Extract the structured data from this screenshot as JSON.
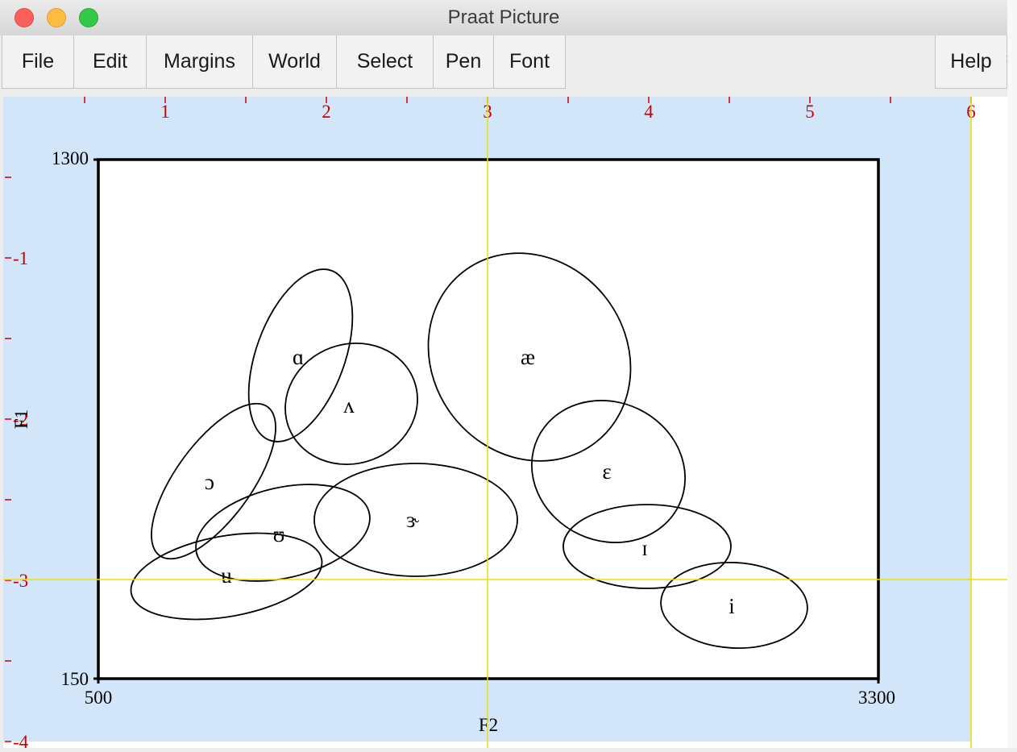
{
  "window": {
    "title": "Praat Picture"
  },
  "menu": [
    {
      "label": "File"
    },
    {
      "label": "Edit"
    },
    {
      "label": "Margins"
    },
    {
      "label": "World"
    },
    {
      "label": "Select"
    },
    {
      "label": "Pen"
    },
    {
      "label": "Font"
    },
    {
      "label": "Help"
    }
  ],
  "colors": {
    "selection": "#d3e5f8",
    "ruler": "#cc0000",
    "guide": "#f0e000",
    "ink": "#000000"
  },
  "rulers": {
    "top": [
      "1",
      "2",
      "3",
      "4",
      "5",
      "6"
    ],
    "left": [
      "-1",
      "-2",
      "-3",
      "-4"
    ]
  },
  "plot": {
    "y_max_label": "1300",
    "y_min_label": "150",
    "x_min_label": "500",
    "x_max_label": "3300",
    "x_axis_label": "F2",
    "y_axis_label": "F1"
  },
  "vowels": [
    {
      "symbol": "ɑ"
    },
    {
      "symbol": "ʌ"
    },
    {
      "symbol": "æ"
    },
    {
      "symbol": "ɔ"
    },
    {
      "symbol": "ɛ"
    },
    {
      "symbol": "ʊ"
    },
    {
      "symbol": "ɝ"
    },
    {
      "symbol": "ɪ"
    },
    {
      "symbol": "u"
    },
    {
      "symbol": "i"
    }
  ]
}
